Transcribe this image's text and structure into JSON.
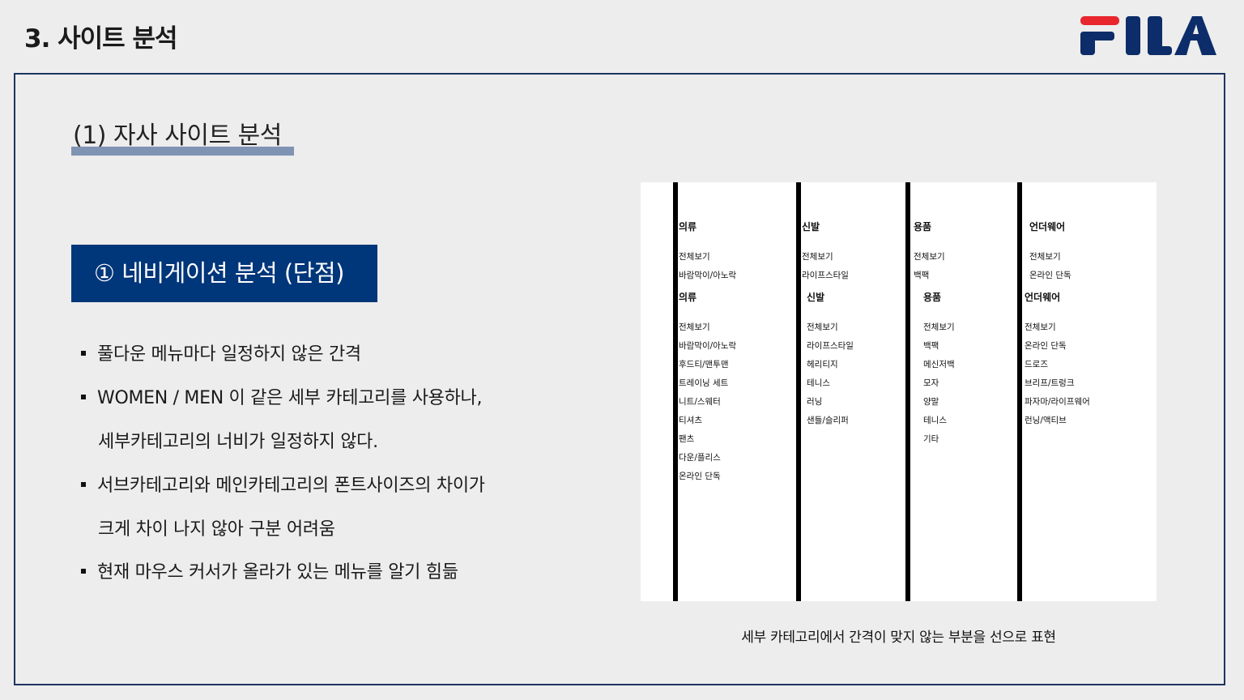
{
  "header": {
    "title": "3. 사이트 분석"
  },
  "logo": {
    "text": "FILA",
    "colors": {
      "red": "#e8262d",
      "navy": "#0c2d69"
    }
  },
  "section": {
    "title": "(1) 자사 사이트 분석"
  },
  "banner": {
    "label": "① 네비게이션 분석 (단점)"
  },
  "bullets": [
    {
      "lines": [
        "풀다운 메뉴마다 일정하지 않은 간격"
      ]
    },
    {
      "lines": [
        "WOMEN / MEN 이 같은 세부 카테고리를 사용하나,",
        "세부카테고리의 너비가 일정하지 않다."
      ]
    },
    {
      "lines": [
        "서브카테고리와 메인카테고리의 폰트사이즈의 차이가",
        "크게 차이 나지 않아 구분 어려움"
      ]
    },
    {
      "lines": [
        "현재 마우스 커서가 올라가 있는 메뉴를 알기 힘듦"
      ]
    }
  ],
  "menu": {
    "top_row": [
      {
        "title": "의류",
        "items": [
          "전체보기",
          "바람막이/아노락"
        ]
      },
      {
        "title": "신발",
        "items": [
          "전체보기",
          "라이프스타일"
        ]
      },
      {
        "title": "용품",
        "items": [
          "전체보기",
          "백팩"
        ]
      },
      {
        "title": "언더웨어",
        "items": [
          "전체보기",
          "온라인 단독"
        ]
      }
    ],
    "bottom_row": [
      {
        "title": "의류",
        "items": [
          "전체보기",
          "바람막이/아노락",
          "후드티/맨투맨",
          "트레이닝 세트",
          "니트/스웨터",
          "티셔츠",
          "팬츠",
          "다운/플리스",
          "온라인 단독"
        ]
      },
      {
        "title": "신발",
        "items": [
          "전체보기",
          "라이프스타일",
          "헤리티지",
          "테니스",
          "러닝",
          "샌들/슬리퍼"
        ]
      },
      {
        "title": "용품",
        "items": [
          "전체보기",
          "백팩",
          "메신저백",
          "모자",
          "양말",
          "테니스",
          "기타"
        ]
      },
      {
        "title": "언더웨어",
        "items": [
          "전체보기",
          "온라인 단독",
          "드로즈",
          "브리프/트렁크",
          "파자마/라이프웨어",
          "런닝/액티브"
        ]
      }
    ]
  },
  "caption": "세부 카테고리에서 간격이 맞지 않는 부분을 선으로 표현",
  "colors": {
    "accent": "#00367a",
    "underline": "#7f93b3",
    "frame": "#1e3561"
  }
}
